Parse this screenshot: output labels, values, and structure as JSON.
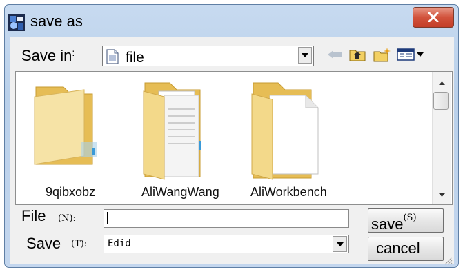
{
  "window": {
    "title": "save as",
    "close_symbol": "x"
  },
  "toolbar": {
    "save_in_label": "Save in",
    "save_in_value": "file",
    "icons": [
      "back-arrow-icon",
      "up-folder-icon",
      "new-folder-icon",
      "views-menu-icon"
    ]
  },
  "files": [
    {
      "name": "9qibxobz",
      "icon": "empty-folder-icon"
    },
    {
      "name": "AliWangWang",
      "icon": "folder-with-documents-icon"
    },
    {
      "name": "AliWorkbench",
      "icon": "folder-with-page-icon"
    }
  ],
  "form": {
    "file_label": "File",
    "file_hint": "(N):",
    "file_value": "",
    "type_label": "Save",
    "type_hint": "(T):",
    "type_value": "Edid"
  },
  "buttons": {
    "save_label": "save",
    "save_hint": "(S)",
    "cancel_label": "cancel"
  },
  "colors": {
    "frame": "#b9d0ea",
    "close_button": "#d2533c",
    "folder_yellow": "#f3d27a"
  }
}
